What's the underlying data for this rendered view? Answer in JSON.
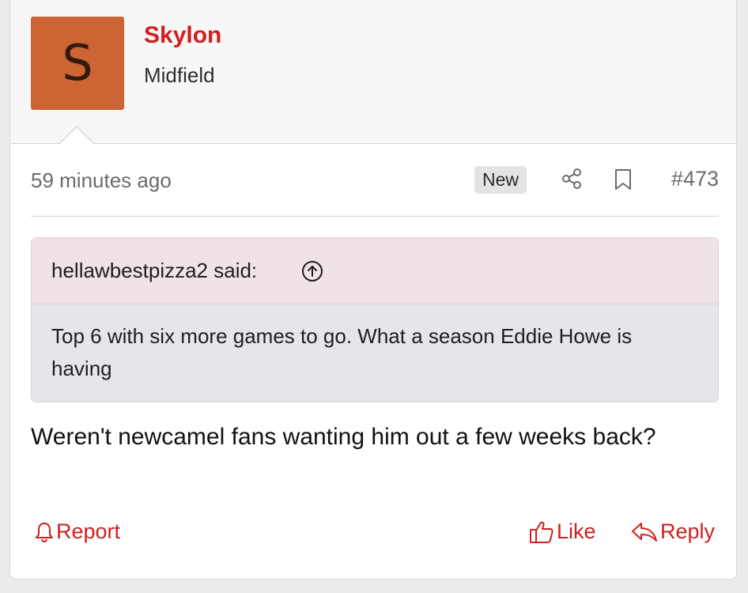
{
  "post": {
    "author": {
      "avatar_letter": "S",
      "avatar_color": "#cc6533",
      "username": "Skylon",
      "user_title": "Midfield"
    },
    "timestamp": "59 minutes ago",
    "badge": "New",
    "post_number": "#473",
    "icons": {
      "share": "share-icon",
      "bookmark": "bookmark-icon"
    },
    "quote": {
      "author_line": "hellawbestpizza2 said:",
      "icon": "arrow-up-circle-icon",
      "text": "Top 6 with six more games to go. What a season Eddie Howe is having"
    },
    "message": "Weren't newcamel fans wanting him out a few weeks back?",
    "actions": {
      "report_label": "Report",
      "like_label": "Like",
      "reply_label": "Reply"
    },
    "colors": {
      "accent": "#d01f1f",
      "quote_header_bg": "#f0e3e6",
      "quote_body_bg": "#e4e6ea"
    }
  }
}
